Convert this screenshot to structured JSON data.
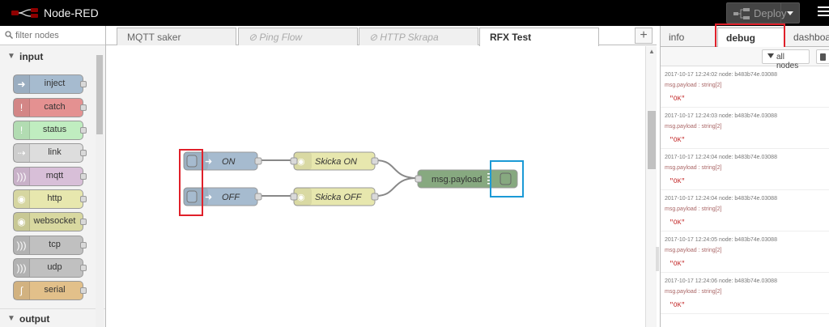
{
  "header": {
    "app_title": "Node-RED",
    "deploy_label": "Deploy"
  },
  "palette": {
    "search_placeholder": "filter nodes",
    "categories": [
      {
        "label": "input"
      },
      {
        "label": "output"
      }
    ],
    "nodes": [
      {
        "label": "inject",
        "color": "#a6bbcf"
      },
      {
        "label": "catch",
        "color": "#e49191"
      },
      {
        "label": "status",
        "color": "#c0edc0"
      },
      {
        "label": "link",
        "color": "#dddddd"
      },
      {
        "label": "mqtt",
        "color": "#d8bfd8"
      },
      {
        "label": "http",
        "color": "#e7e7ae"
      },
      {
        "label": "websocket",
        "color": "#d8d8a0"
      },
      {
        "label": "tcp",
        "color": "#c0c0c0"
      },
      {
        "label": "udp",
        "color": "#c0c0c0"
      },
      {
        "label": "serial",
        "color": "#e2c08a"
      }
    ]
  },
  "tabs": [
    {
      "label": "MQTT saker",
      "state": "normal"
    },
    {
      "label": "Ping Flow",
      "state": "disabled"
    },
    {
      "label": "HTTP Skrapa",
      "state": "disabled"
    },
    {
      "label": "RFX Test",
      "state": "active"
    }
  ],
  "flow": {
    "inject_on": "ON",
    "inject_off": "OFF",
    "func_on": "Skicka ON",
    "func_off": "Skicka OFF",
    "debug_node": "msg.payload"
  },
  "sidebar": {
    "tabs": [
      {
        "label": "info"
      },
      {
        "label": "debug"
      },
      {
        "label": "dashboar"
      }
    ],
    "filter_label": "all nodes",
    "messages": [
      {
        "meta": "2017-10-17 12:24:02    node: b483b74e.03088",
        "topic": "msg.payload : string[2]",
        "value": "\"OK\""
      },
      {
        "meta": "2017-10-17 12:24:03    node: b483b74e.03088",
        "topic": "msg.payload : string[2]",
        "value": "\"OK\""
      },
      {
        "meta": "2017-10-17 12:24:04    node: b483b74e.03088",
        "topic": "msg.payload : string[2]",
        "value": "\"OK\""
      },
      {
        "meta": "2017-10-17 12:24:04    node: b483b74e.03088",
        "topic": "msg.payload : string[2]",
        "value": "\"OK\""
      },
      {
        "meta": "2017-10-17 12:24:05    node: b483b74e.03088",
        "topic": "msg.payload : string[2]",
        "value": "\"OK\""
      },
      {
        "meta": "2017-10-17 12:24:06    node: b483b74e.03088",
        "topic": "msg.payload : string[2]",
        "value": "\"OK\""
      }
    ]
  },
  "colors": {
    "inject": "#a6bbcf",
    "function": "#e7e7ae",
    "debug": "#87a980",
    "highlight_red": "#e0202a",
    "highlight_blue": "#1b9ad6"
  }
}
